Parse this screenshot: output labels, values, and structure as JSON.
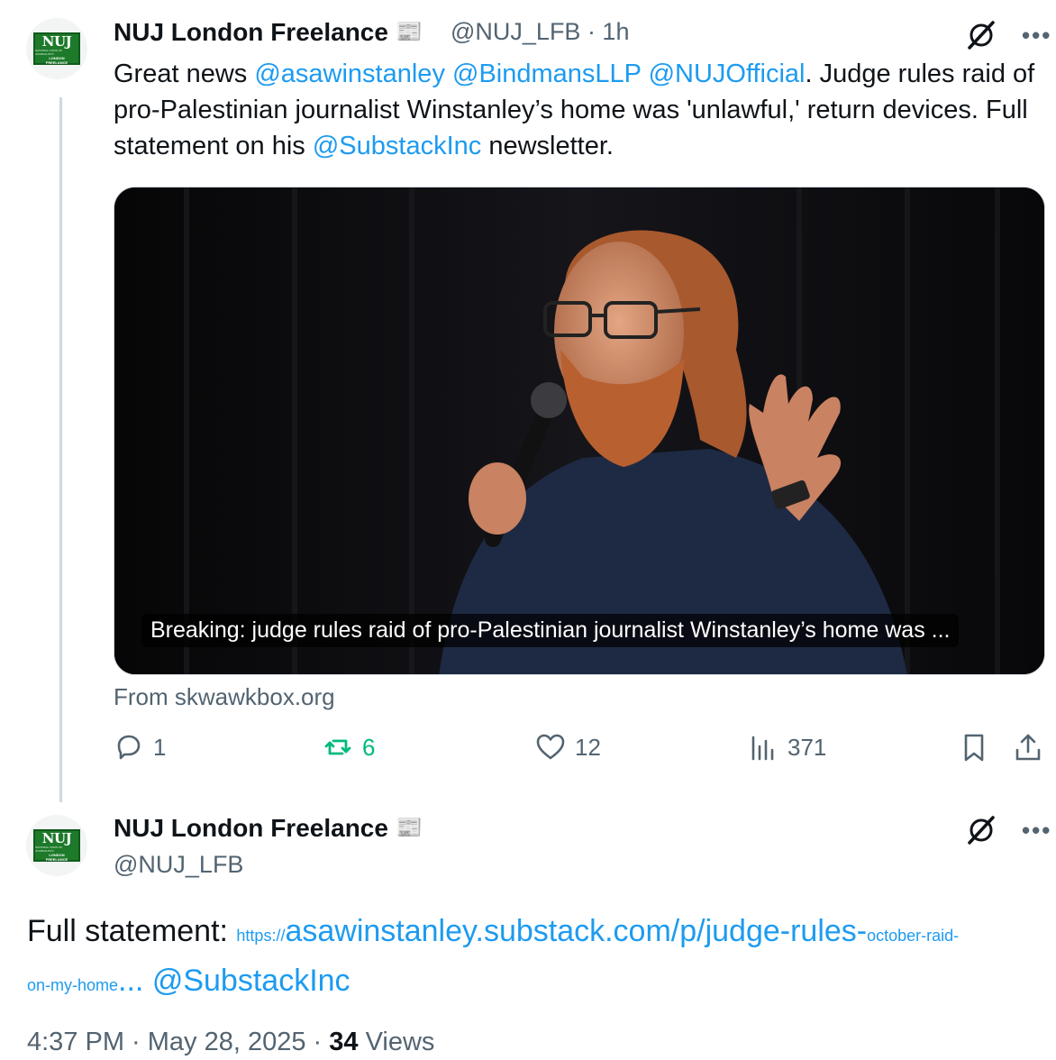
{
  "reply_tweet": {
    "avatar": {
      "logo_text": "NUJ",
      "logo_sub": "NATIONAL UNION OF JOURNALISTS",
      "logo_london": "LONDON",
      "logo_freelance": "FREELANCE"
    },
    "author_name": "NUJ London Freelance",
    "badge_icon": "newspaper-icon",
    "handle_time": "@NUJ_LFB · 1h",
    "text": {
      "t1": "Great news ",
      "m1": "@asawinstanley",
      "t2": " ",
      "m2": "@BindmansLLP",
      "t3": " ",
      "m3": "@NUJOfficial",
      "t4": ". Judge rules raid of pro-Palestinian journalist Winstanley’s home was 'unlawful,' return devices. Full statement on his ",
      "m4": "@SubstackInc",
      "t5": " newsletter."
    },
    "card": {
      "caption": "Breaking: judge rules raid of pro-Palestinian journalist Winstanley’s home was ...",
      "source": "From skwawkbox.org"
    },
    "actions": {
      "replies": "1",
      "retweets": "6",
      "likes": "12",
      "views": "371"
    }
  },
  "main_tweet": {
    "author_name": "NUJ London Freelance",
    "handle": "@NUJ_LFB",
    "text_label": "Full statement: ",
    "link": {
      "prefix": "https://",
      "main": "asawinstanley.substack.com/p/judge-rules-",
      "tail1": "october-raid-",
      "tail2": "on-my-home",
      "ellipsis": "..."
    },
    "mention": "@SubstackInc",
    "time": "4:37 PM · May 28, 2025 · ",
    "views_count": "34",
    "views_label": " Views"
  },
  "colors": {
    "accent": "#1d9bf0",
    "retweet": "#00ba7c",
    "muted": "#536471",
    "text": "#0f1419"
  }
}
